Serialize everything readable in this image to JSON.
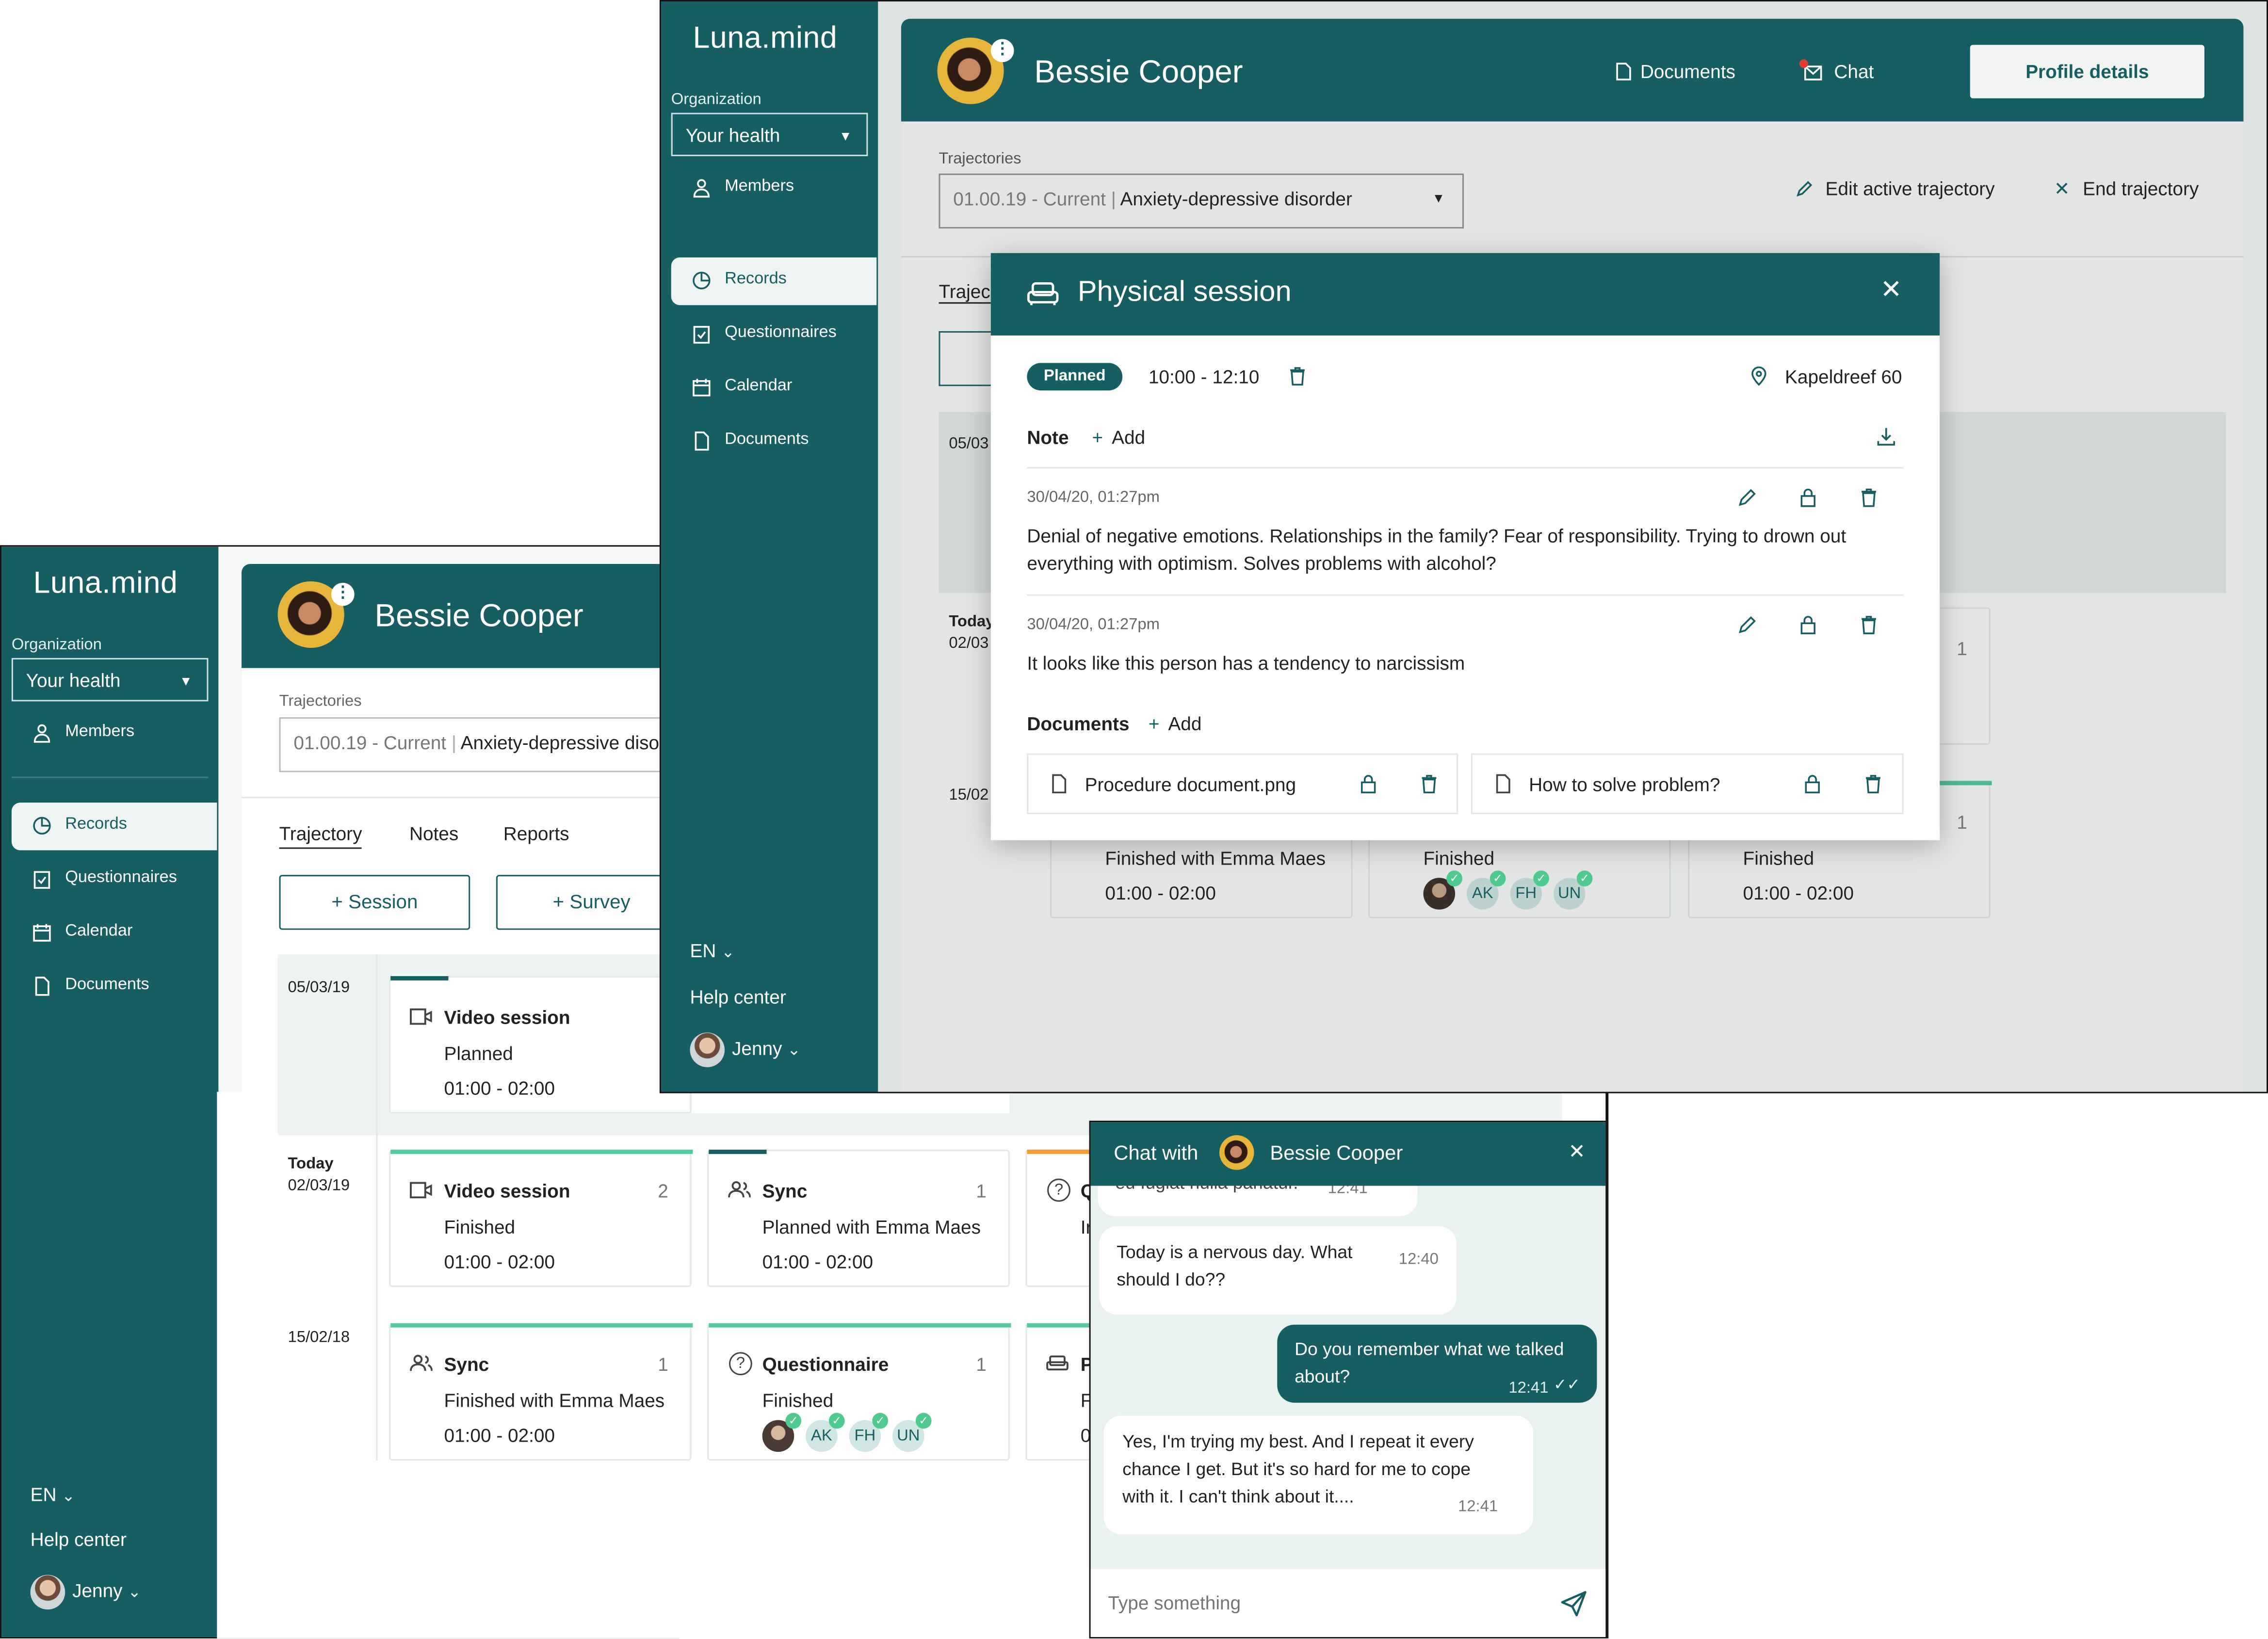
{
  "app": {
    "logo": "Luna.mind",
    "org_label": "Organization",
    "org_value": "Your health",
    "nav": {
      "members": "Members",
      "records": "Records",
      "questionnaires": "Questionnaires",
      "calendar": "Calendar",
      "documents": "Documents"
    },
    "lang": "EN",
    "help": "Help center",
    "user": "Jenny"
  },
  "patient": {
    "name": "Bessie Cooper",
    "header_documents": "Documents",
    "header_chat": "Chat",
    "profile_button": "Profile details"
  },
  "trajectory": {
    "label": "Trajectories",
    "period": "01.00.19 - Current",
    "diagnosis": "Anxiety-depressive disorder",
    "edit": "Edit active trajectory",
    "end": "End trajectory",
    "partial_tab": "Trajec"
  },
  "tabs": {
    "trajectory": "Trajectory",
    "notes": "Notes",
    "reports": "Reports"
  },
  "actions": {
    "session": "Session",
    "survey": "Survey"
  },
  "timeline": {
    "row1_date": "05/03/19",
    "row2_today": "Today",
    "row2_date": "02/03/19",
    "row3_date": "15/02/18",
    "back_row1_date": "05/03",
    "back_row2_date": "02/03",
    "back_row3_date": "15/02",
    "back_row2_count": "1",
    "back_row3_count": "1",
    "back_card1_l2": "Finished with Emma Maes",
    "back_card1_l3": "01:00 - 02:00",
    "back_card2_l2": "Finished",
    "back_card3_l2": "Finished",
    "back_card3_l3": "01:00 - 02:00",
    "c1": {
      "title": "Video session",
      "status": "Planned",
      "time": "01:00 - 02:00"
    },
    "c2": {
      "title": "Video session",
      "count": "2",
      "status": "Finished",
      "time": "01:00 - 02:00"
    },
    "c3": {
      "title": "Sync",
      "count": "1",
      "status": "Planned with Emma Maes",
      "time": "01:00 - 02:00"
    },
    "c4": {
      "title": "Q",
      "status": "Ir"
    },
    "c5": {
      "title": "Sync",
      "count": "1",
      "status": "Finished with Emma Maes",
      "time": "01:00 - 02:00"
    },
    "c6": {
      "title": "Questionnaire",
      "count": "1",
      "status": "Finished"
    },
    "c7": {
      "title": "P",
      "status": "F",
      "time": "0"
    },
    "participants": [
      "AK",
      "FH",
      "UN"
    ]
  },
  "modal": {
    "title": "Physical session",
    "status": "Planned",
    "time": "10:00 - 12:10",
    "location": "Kapeldreef 60",
    "note_label": "Note",
    "add": "Add",
    "notes": [
      {
        "ts": "30/04/20, 01:27pm",
        "text": "Denial of negative emotions. Relationships in the family? Fear of responsibility. Trying to drown out everything with optimism. Solves problems with alcohol?"
      },
      {
        "ts": "30/04/20, 01:27pm",
        "text": "It looks like this person has a tendency to narcissism"
      }
    ],
    "documents_label": "Documents",
    "documents": [
      "Procedure document.png",
      "How to solve problem?"
    ]
  },
  "chat": {
    "title_prefix": "Chat with",
    "name": "Bessie Cooper",
    "partial_msg": "eu fugiat nulla pariatur.",
    "partial_time": "12:41",
    "messages": [
      {
        "text": "Today is a nervous day. What should I do??",
        "time": "12:40",
        "dir": "in"
      },
      {
        "text": "Do you remember what we talked about?",
        "time": "12:41",
        "dir": "out"
      },
      {
        "text": "Yes, I'm trying my best. And I repeat it every chance I get. But it's so hard for me to cope with it. I can't think about it....",
        "time": "12:41",
        "dir": "in"
      }
    ],
    "placeholder": "Type something"
  },
  "colors": {
    "primary": "#175e63",
    "accent_green": "#4fcb8f",
    "accent_orange": "#f29b38",
    "badge_red": "#e53935"
  }
}
